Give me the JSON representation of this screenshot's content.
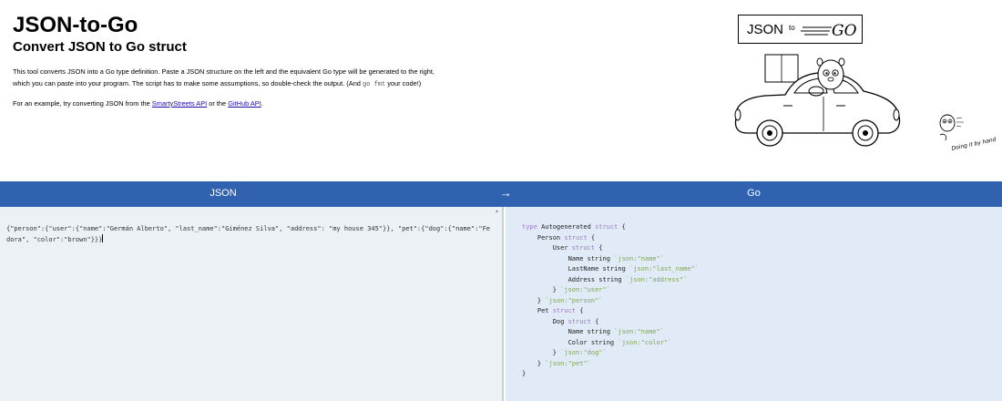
{
  "header": {
    "title": "JSON-to-Go",
    "subtitle": "Convert JSON to Go struct",
    "intro_line1": "This tool converts JSON into a Go type definition. Paste a JSON structure on the left and the equivalent Go type will be generated to the right,",
    "intro_line2a": "which you can paste into your program. The script has to make some assumptions, so double-check the output. (And ",
    "intro_code": "go fmt",
    "intro_line2b": " your code!)",
    "example_prefix": "For an example, try converting JSON from the ",
    "link_smartystreets": "SmartyStreets API",
    "example_or": " or the ",
    "link_github": "GitHub API",
    "example_suffix": "."
  },
  "logo": {
    "json": "JSON",
    "to": "to",
    "go": "GO",
    "doing_label": "Doing it by hand"
  },
  "bar": {
    "left_label": "JSON",
    "arrow": "→",
    "right_label": "Go"
  },
  "json_input": {
    "value": "{\"person\":{\"user\":{\"name\":\"Germán Alberto\", \"last_name\":\"Giménez Silva\", \"address\": \"my house 345\"}}, \"pet\":{\"dog\":{\"name\":\"Fedora\", \"color\":\"brown\"}}}"
  },
  "go_output": {
    "lines": [
      "type Autogenerated struct {",
      "    Person struct {",
      "        User struct {",
      "            Name string `json:\"name\"`",
      "            LastName string `json:\"last_name\"`",
      "            Address string `json:\"address\"`",
      "        } `json:\"user\"`",
      "    } `json:\"person\"`",
      "    Pet struct {",
      "        Dog struct {",
      "            Name string `json:\"name\"`",
      "            Color string `json:\"color\"`",
      "        } `json:\"dog\"`",
      "    } `json:\"pet\"`",
      "}"
    ]
  },
  "colors": {
    "bar": "#3062b0",
    "left_pane": "#ecf1f6",
    "right_pane": "#e1ebf7",
    "keyword": "#9b7bc3",
    "struct_tag": "#7ea64f",
    "link": "#1a0dab"
  },
  "icons": {
    "car_illustration": "gopher-driving-car",
    "small_gopher": "gopher-typing"
  }
}
